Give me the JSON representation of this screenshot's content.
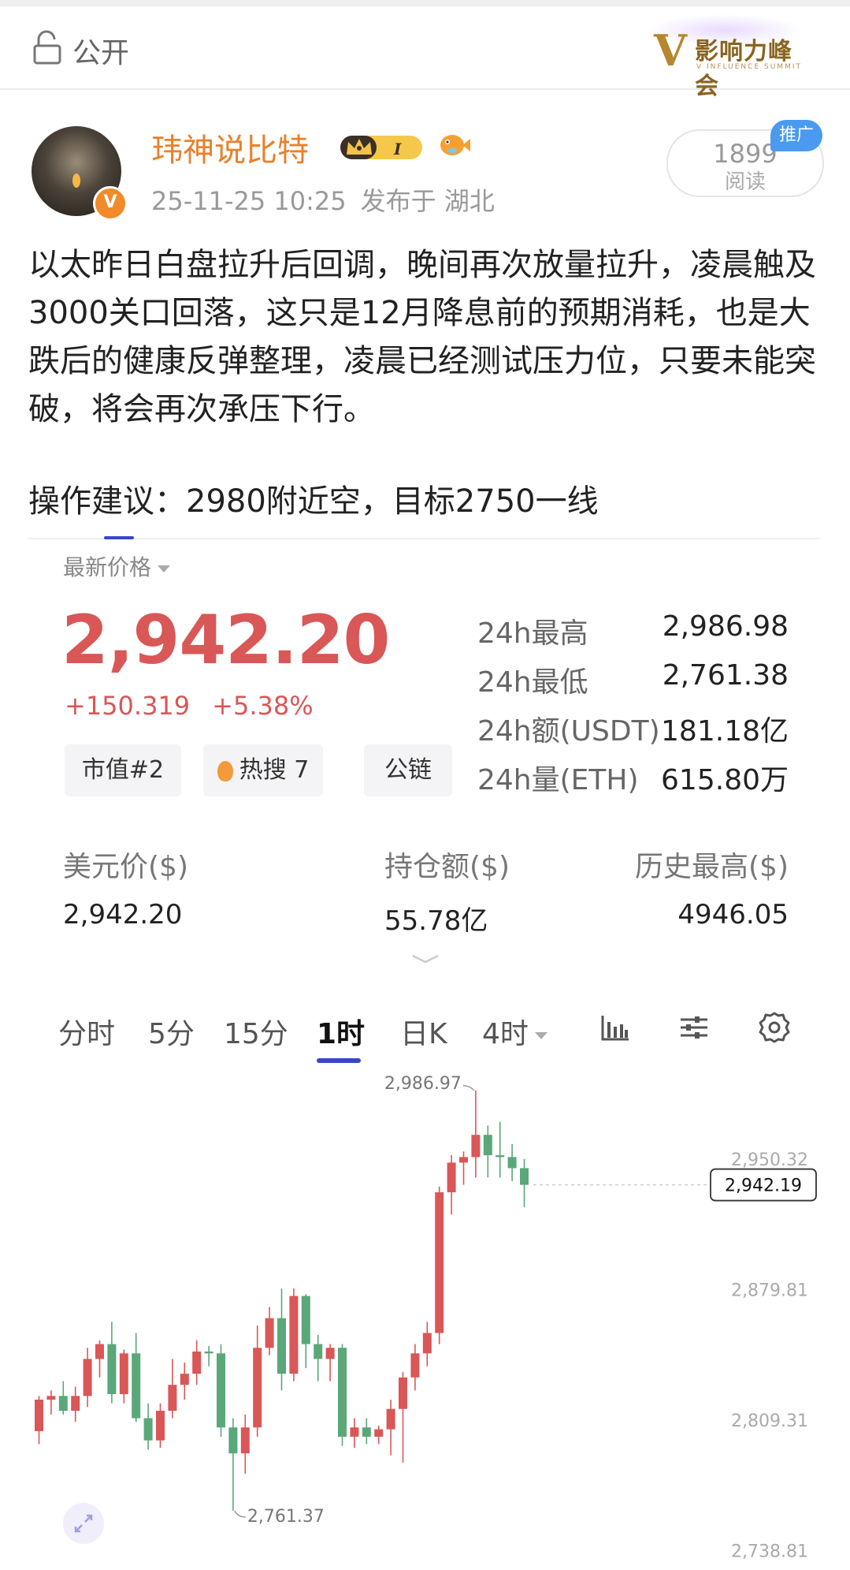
{
  "header": {
    "visibility_label": "公开",
    "logo": {
      "mark": "V",
      "text": "影响力峰会",
      "subtitle": "V INFLUENCE SUMMIT"
    }
  },
  "author": {
    "name": "玮神说比特",
    "level_badge": "I",
    "verified_badge": "V",
    "time": "25-11-25 10:25",
    "location": "发布于 湖北"
  },
  "reads": {
    "count": "1899",
    "label": "阅读",
    "promo_tag": "推广"
  },
  "post": {
    "text": "以太昨日白盘拉升后回调，晚间再次放量拉升，凌晨触及3000关口回落，这只是12月降息前的预期消耗，也是大跌后的健康反弹整理，凌晨已经测试压力位，只要未能突破，将会再次承压下行。",
    "advice": "操作建议：2980附近空，目标2750一线"
  },
  "market": {
    "latest_label": "最新价格",
    "price": "2,942.20",
    "change_abs": "+150.319",
    "change_pct": "+5.38%",
    "tags": [
      "市值#2",
      "热搜 7",
      "公链"
    ],
    "stats": [
      {
        "label": "24h最高",
        "value": "2,986.98"
      },
      {
        "label": "24h最低",
        "value": "2,761.38"
      },
      {
        "label": "24h额(USDT)",
        "value": "181.18亿"
      },
      {
        "label": "24h量(ETH)",
        "value": "615.80万"
      }
    ],
    "usd_row": [
      {
        "label": "美元价($)",
        "value": "2,942.20"
      },
      {
        "label": "持仓额($)",
        "value": "55.78亿"
      },
      {
        "label": "历史最高($)",
        "value": "4946.05"
      }
    ]
  },
  "timeframes": {
    "tabs": [
      "分时",
      "5分",
      "15分",
      "1时",
      "日K",
      "4时"
    ],
    "active": "1时",
    "icons": [
      "bar-chart-icon",
      "indicator-settings-icon",
      "gear-icon"
    ]
  },
  "colors": {
    "up": "#d95757",
    "down": "#5aa77a",
    "accent": "#3a46c8",
    "username": "#e8812c"
  },
  "chart_data": {
    "type": "candlestick",
    "title": "",
    "y_ticks": [
      2950.32,
      2879.81,
      2809.31,
      2738.81
    ],
    "y_tick_labels": [
      "2,950.32",
      "2,879.81",
      "2,809.31",
      "2,738.81"
    ],
    "ylim": [
      2731,
      2995
    ],
    "current_price_label": "2,942.19",
    "high_annotation": "2,986.97",
    "low_annotation": "2,761.37",
    "candles": [
      {
        "o": 2803,
        "h": 2822,
        "l": 2796,
        "c": 2820
      },
      {
        "o": 2820,
        "h": 2825,
        "l": 2812,
        "c": 2822
      },
      {
        "o": 2822,
        "h": 2830,
        "l": 2812,
        "c": 2814
      },
      {
        "o": 2814,
        "h": 2827,
        "l": 2808,
        "c": 2822
      },
      {
        "o": 2822,
        "h": 2848,
        "l": 2816,
        "c": 2842
      },
      {
        "o": 2842,
        "h": 2852,
        "l": 2832,
        "c": 2850
      },
      {
        "o": 2850,
        "h": 2862,
        "l": 2818,
        "c": 2823
      },
      {
        "o": 2823,
        "h": 2847,
        "l": 2818,
        "c": 2845
      },
      {
        "o": 2845,
        "h": 2856,
        "l": 2808,
        "c": 2810
      },
      {
        "o": 2810,
        "h": 2818,
        "l": 2793,
        "c": 2798
      },
      {
        "o": 2798,
        "h": 2818,
        "l": 2794,
        "c": 2814
      },
      {
        "o": 2814,
        "h": 2842,
        "l": 2810,
        "c": 2828
      },
      {
        "o": 2828,
        "h": 2840,
        "l": 2820,
        "c": 2834
      },
      {
        "o": 2834,
        "h": 2852,
        "l": 2828,
        "c": 2846
      },
      {
        "o": 2846,
        "h": 2849,
        "l": 2838,
        "c": 2845
      },
      {
        "o": 2845,
        "h": 2850,
        "l": 2800,
        "c": 2805
      },
      {
        "o": 2805,
        "h": 2810,
        "l": 2760,
        "c": 2791
      },
      {
        "o": 2791,
        "h": 2812,
        "l": 2780,
        "c": 2805
      },
      {
        "o": 2805,
        "h": 2860,
        "l": 2800,
        "c": 2848
      },
      {
        "o": 2848,
        "h": 2870,
        "l": 2844,
        "c": 2864
      },
      {
        "o": 2864,
        "h": 2880,
        "l": 2825,
        "c": 2834
      },
      {
        "o": 2834,
        "h": 2880,
        "l": 2830,
        "c": 2876
      },
      {
        "o": 2876,
        "h": 2877,
        "l": 2837,
        "c": 2850
      },
      {
        "o": 2850,
        "h": 2855,
        "l": 2830,
        "c": 2842
      },
      {
        "o": 2842,
        "h": 2850,
        "l": 2830,
        "c": 2848
      },
      {
        "o": 2848,
        "h": 2850,
        "l": 2795,
        "c": 2800
      },
      {
        "o": 2800,
        "h": 2810,
        "l": 2794,
        "c": 2805
      },
      {
        "o": 2805,
        "h": 2810,
        "l": 2796,
        "c": 2800
      },
      {
        "o": 2800,
        "h": 2806,
        "l": 2796,
        "c": 2804
      },
      {
        "o": 2804,
        "h": 2820,
        "l": 2790,
        "c": 2815
      },
      {
        "o": 2815,
        "h": 2835,
        "l": 2786,
        "c": 2832
      },
      {
        "o": 2832,
        "h": 2850,
        "l": 2825,
        "c": 2845
      },
      {
        "o": 2845,
        "h": 2862,
        "l": 2838,
        "c": 2856
      },
      {
        "o": 2856,
        "h": 2935,
        "l": 2850,
        "c": 2932
      },
      {
        "o": 2932,
        "h": 2952,
        "l": 2920,
        "c": 2948
      },
      {
        "o": 2948,
        "h": 2954,
        "l": 2936,
        "c": 2951
      },
      {
        "o": 2951,
        "h": 2987,
        "l": 2940,
        "c": 2963
      },
      {
        "o": 2963,
        "h": 2968,
        "l": 2940,
        "c": 2952
      },
      {
        "o": 2952,
        "h": 2970,
        "l": 2940,
        "c": 2951
      },
      {
        "o": 2951,
        "h": 2958,
        "l": 2938,
        "c": 2945
      },
      {
        "o": 2945,
        "h": 2950,
        "l": 2924,
        "c": 2936
      }
    ]
  }
}
